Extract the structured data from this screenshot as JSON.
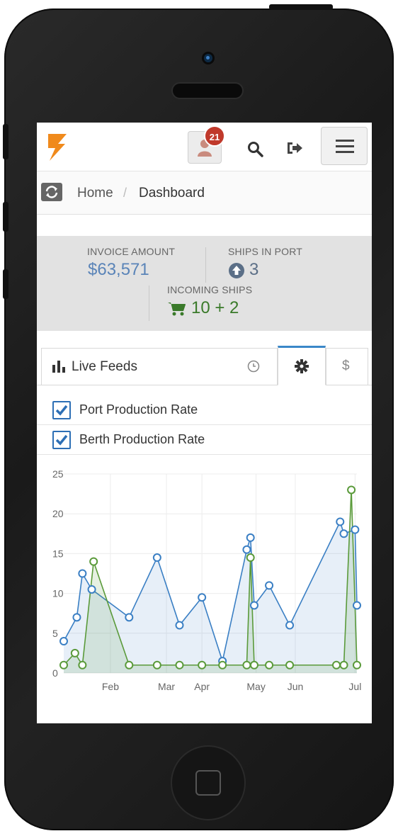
{
  "header": {
    "notification_count": "21"
  },
  "breadcrumb": {
    "home": "Home",
    "separator": "/",
    "current": "Dashboard"
  },
  "stats": {
    "invoice": {
      "label": "INVOICE AMOUNT",
      "value": "$63,571"
    },
    "ships_in_port": {
      "label": "SHIPS IN PORT",
      "value": "3"
    },
    "incoming": {
      "label": "INCOMING SHIPS",
      "value": "10 + 2"
    }
  },
  "tabs": {
    "live_feeds": "Live Feeds",
    "dollar": "$"
  },
  "legend": [
    {
      "label": "Port Production Rate",
      "checked": true
    },
    {
      "label": "Berth Production Rate",
      "checked": true
    }
  ],
  "colors": {
    "port": "#3a7fc4",
    "berth": "#5a9a3a",
    "brand": "#f08a1c",
    "badge": "#c0392b",
    "stat_value": "#5a84b8",
    "stat_green": "#3a7a2a"
  },
  "chart_data": {
    "type": "line",
    "ylim": [
      0,
      25
    ],
    "yticks": [
      "0",
      "5",
      "10",
      "15",
      "20",
      "25"
    ],
    "xticks": [
      "Feb",
      "Mar",
      "Apr",
      "May",
      "Jun",
      "Jul"
    ],
    "xtick_positions": [
      39.0,
      69.0,
      88.0,
      117.0,
      138.0,
      170.0
    ],
    "x_range": [
      14,
      171
    ],
    "grid": true,
    "series": [
      {
        "name": "Port Production Rate",
        "fill": true,
        "points": [
          [
            14,
            4
          ],
          [
            21,
            7
          ],
          [
            24,
            12.5
          ],
          [
            29,
            10.5
          ],
          [
            49,
            7
          ],
          [
            64,
            14.5
          ],
          [
            76,
            6
          ],
          [
            88,
            9.5
          ],
          [
            99,
            1.5
          ],
          [
            112,
            15.5
          ],
          [
            114,
            17
          ],
          [
            116,
            8.5
          ],
          [
            124,
            11
          ],
          [
            135,
            6
          ],
          [
            162,
            19
          ],
          [
            164,
            17.5
          ],
          [
            170,
            18
          ],
          [
            171,
            8.5
          ]
        ]
      },
      {
        "name": "Berth Production Rate",
        "fill": true,
        "points": [
          [
            14,
            1
          ],
          [
            20,
            2.5
          ],
          [
            24,
            1
          ],
          [
            30,
            14
          ],
          [
            49,
            1
          ],
          [
            64,
            1
          ],
          [
            76,
            1
          ],
          [
            88,
            1
          ],
          [
            99,
            1
          ],
          [
            112,
            1
          ],
          [
            114,
            14.5
          ],
          [
            116,
            1
          ],
          [
            124,
            1
          ],
          [
            135,
            1
          ],
          [
            160,
            1
          ],
          [
            164,
            1
          ],
          [
            168,
            23
          ],
          [
            171,
            1
          ]
        ]
      }
    ]
  }
}
